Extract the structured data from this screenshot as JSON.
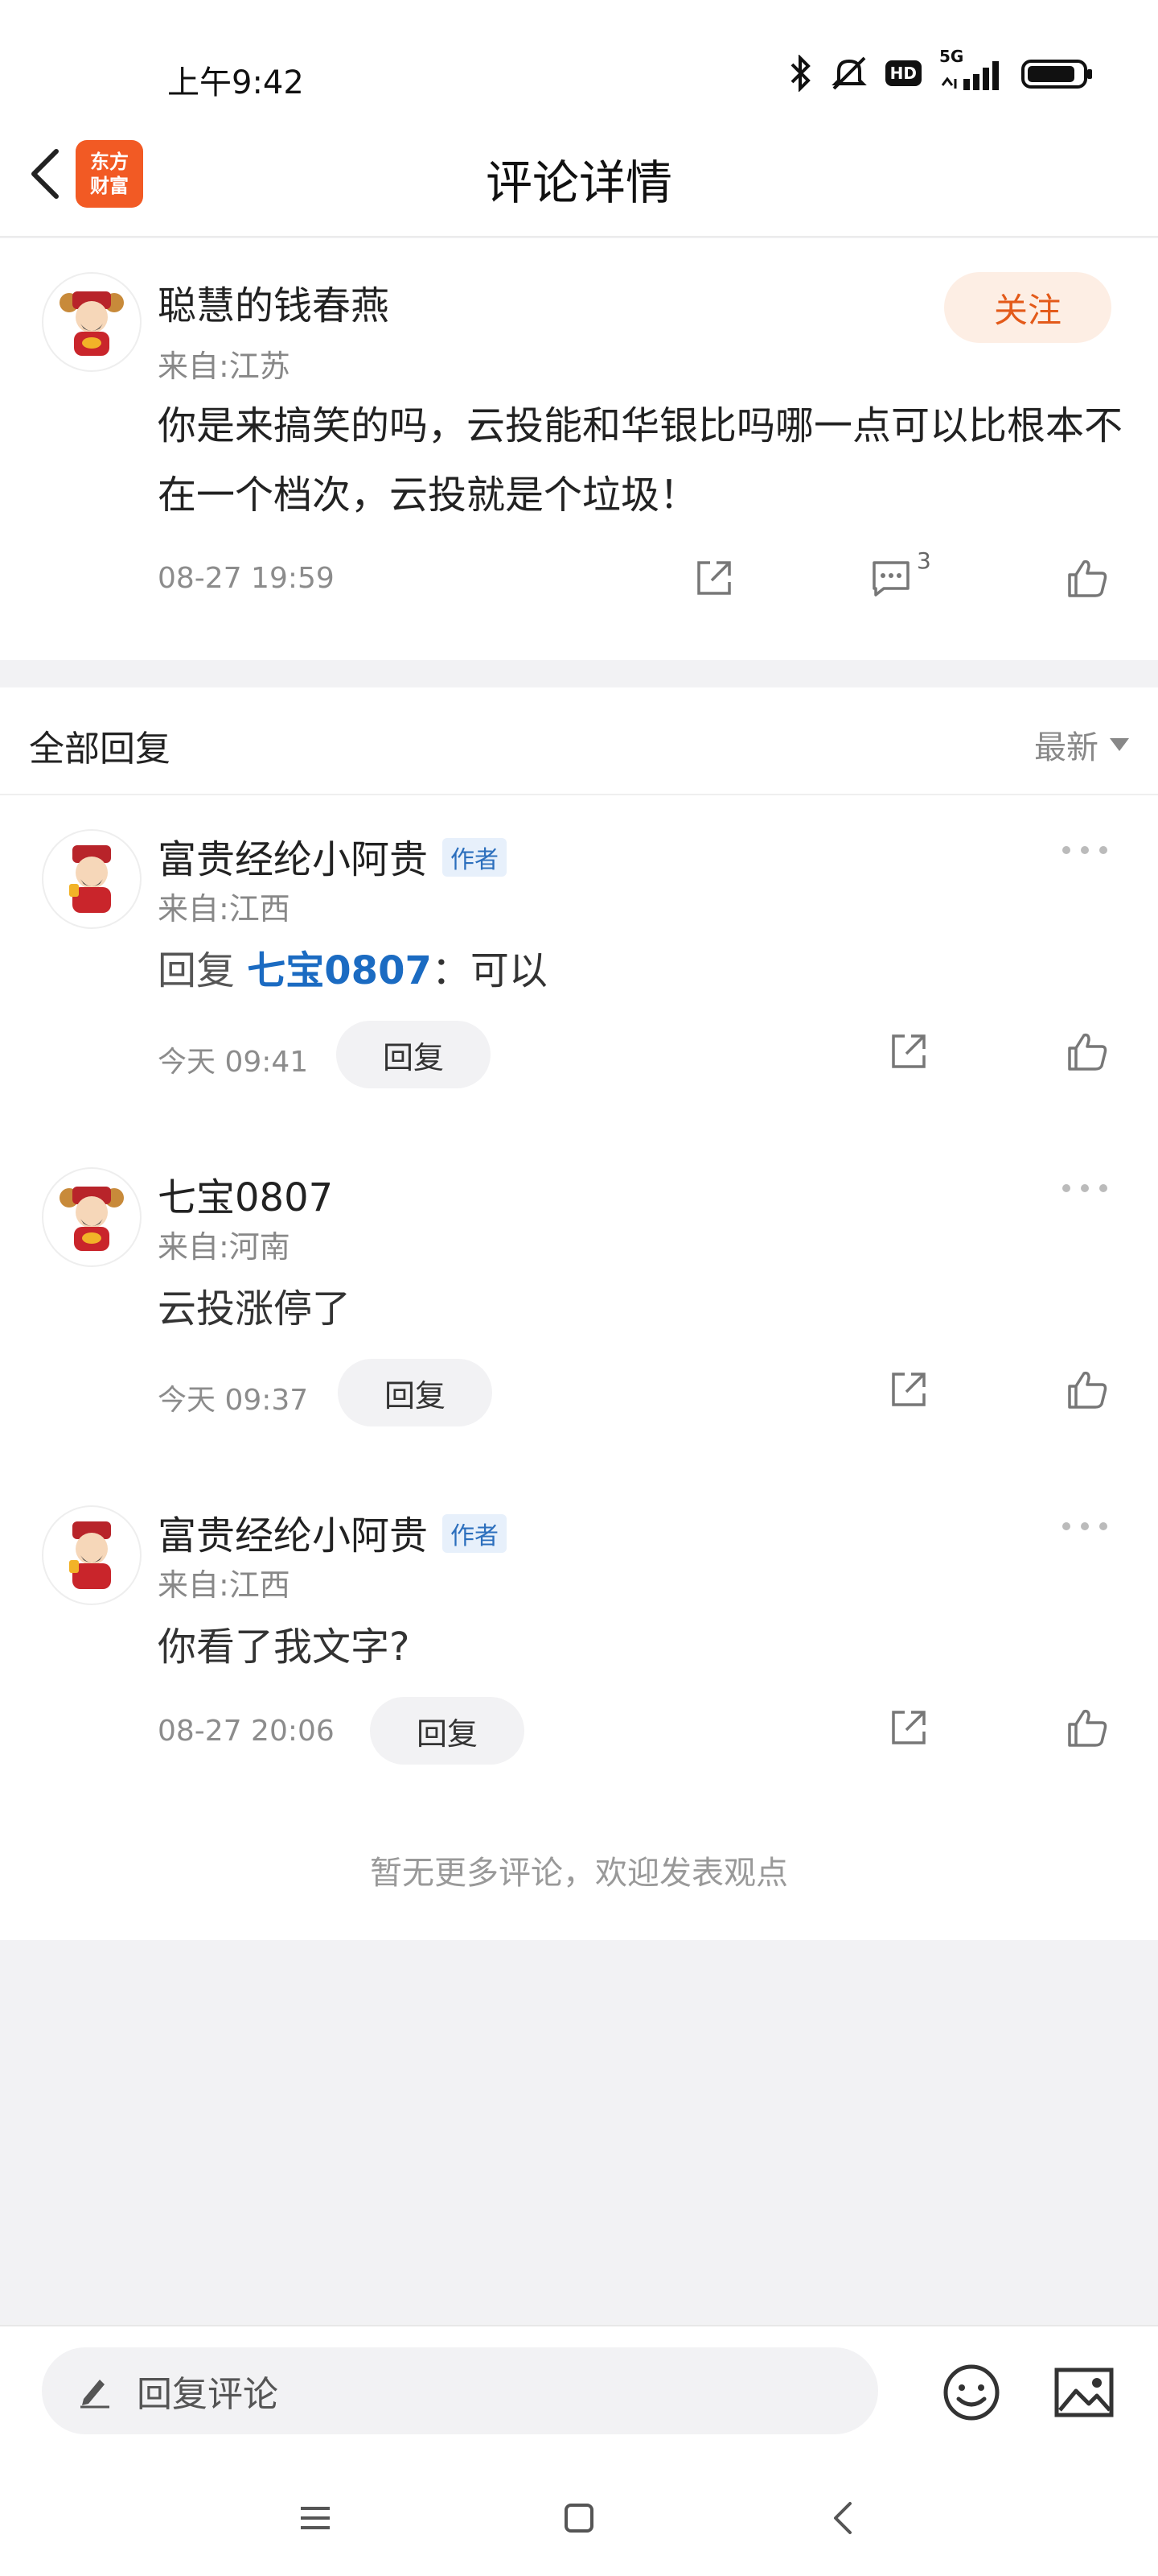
{
  "status_bar": {
    "time": "上午9:42",
    "network": "5G",
    "hd": "HD"
  },
  "nav": {
    "title": "评论详情",
    "logo_line1": "东方",
    "logo_line2": "财富"
  },
  "main_comment": {
    "username": "聪慧的钱春燕",
    "location": "来自:江苏",
    "follow_label": "关注",
    "text": "你是来搞笑的吗，云投能和华银比吗哪一点可以比根本不在一个档次，云投就是个垃圾！",
    "time": "08-27 19:59",
    "comment_count": "3"
  },
  "replies": {
    "title": "全部回复",
    "sort": "最新",
    "reply_button_label": "回复",
    "author_badge": "作者",
    "items": [
      {
        "username": "富贵经纶小阿贵",
        "location": "来自:江西",
        "prefix": "回复",
        "mention": "七宝0807",
        "text": "：可以",
        "time": "今天 09:41"
      },
      {
        "username": "七宝0807",
        "location": "来自:河南",
        "text": "云投涨停了",
        "time": "今天 09:37"
      },
      {
        "username": "富贵经纶小阿贵",
        "location": "来自:江西",
        "text": "你看了我文字?",
        "time": "08-27 20:06"
      }
    ],
    "no_more": "暂无更多评论，欢迎发表观点"
  },
  "bottom_bar": {
    "input_placeholder": "回复评论"
  },
  "colors": {
    "accent": "#e35a1a",
    "mention": "#1b6bc2",
    "logo": "#f25a24"
  }
}
